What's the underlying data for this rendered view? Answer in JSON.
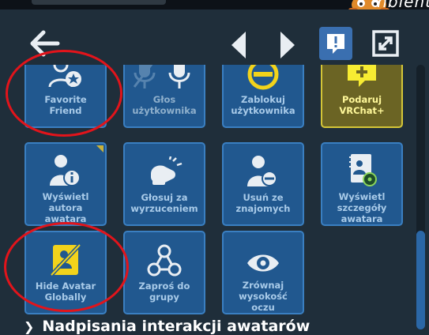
{
  "corner_text": "nbient",
  "header": {
    "back_icon": "arrow-left-icon",
    "prev_icon": "chevron-left-icon",
    "next_icon": "chevron-right-icon",
    "report_icon": "exclamation-bubble-icon",
    "expand_icon": "expand-window-icon",
    "accent": "#3a6fb0"
  },
  "tiles": [
    {
      "label": "Favorite Friend",
      "icon": "favorite-friend-icon"
    },
    {
      "label": "Głos użytkownika",
      "icon": "microphone-muted-icon"
    },
    {
      "label": "Zablokuj użytkownika",
      "icon": "block-icon"
    },
    {
      "label": "Podaruj VRChat+",
      "icon": "vrchat-plus-gift-icon"
    },
    {
      "label": "Wyświetl autora awatara",
      "icon": "avatar-author-info-icon"
    },
    {
      "label": "Głosuj za wyrzuceniem",
      "icon": "vote-kick-icon"
    },
    {
      "label": "Usuń ze znajomych",
      "icon": "remove-friend-icon"
    },
    {
      "label": "Wyświetl szczegóły awatara",
      "icon": "avatar-details-icon"
    },
    {
      "label": "Hide Avatar Globally",
      "icon": "hide-avatar-icon"
    },
    {
      "label": "Zaproś do grupy",
      "icon": "group-invite-icon"
    },
    {
      "label": "Zrównaj wysokość oczu",
      "icon": "eye-height-icon"
    }
  ],
  "section": {
    "title": "Nadpisania interakcji awatarów",
    "icon": "chevron-right-icon"
  },
  "colors": {
    "tile_bg": "#21588f",
    "tile_border": "#3a7fc1",
    "gold_bg": "#6b6424",
    "gold_border": "#d4c638",
    "highlight_circle": "#e2141b"
  }
}
